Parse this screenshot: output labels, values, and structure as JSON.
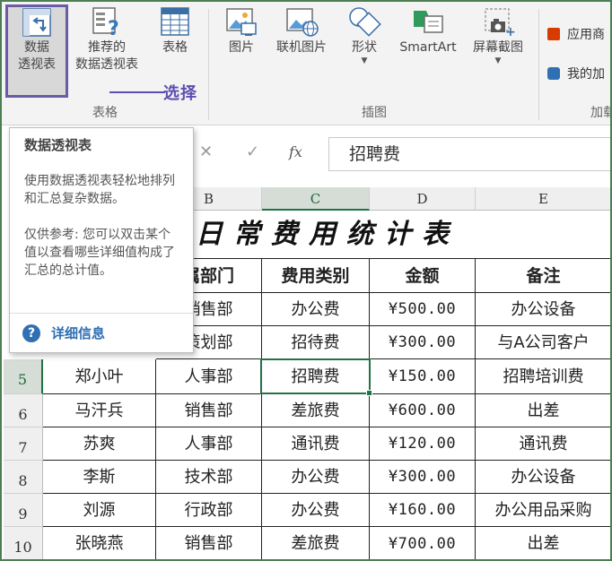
{
  "ribbon": {
    "buttons": {
      "pivot_table": {
        "label1": "数据",
        "label2": "透视表"
      },
      "recommended_pivot": {
        "label1": "推荐的",
        "label2": "数据透视表"
      },
      "table": {
        "label1": "表格"
      },
      "picture": {
        "label1": "图片"
      },
      "online_picture": {
        "label1": "联机图片"
      },
      "shapes": {
        "label1": "形状"
      },
      "smartart": {
        "label1": "SmartArt"
      },
      "screenshot": {
        "label1": "屏幕截图"
      }
    },
    "side": {
      "app_item": "应用商",
      "my_addins": "我的加"
    },
    "groups": {
      "tables": "表格",
      "illustrations": "插图",
      "addins": "加载"
    },
    "annotation": "选择"
  },
  "formula_bar": {
    "fx": "fx",
    "value": "招聘费"
  },
  "columns": [
    "B",
    "C",
    "D",
    "E"
  ],
  "selected_column": "C",
  "rows": [
    "5",
    "6",
    "7",
    "8",
    "9",
    "10"
  ],
  "selected_row": "5",
  "sheet": {
    "title": "日常费用统计表",
    "headers": [
      "属部门",
      "费用类别",
      "金额",
      "备注"
    ],
    "data": [
      {
        "name": "",
        "dept": "销售部",
        "type": "办公费",
        "amount": "¥500.00",
        "note": "办公设备"
      },
      {
        "name": "",
        "dept": "策划部",
        "type": "招待费",
        "amount": "¥300.00",
        "note": "与A公司客户"
      },
      {
        "name": "郑小叶",
        "dept": "人事部",
        "type": "招聘费",
        "amount": "¥150.00",
        "note": "招聘培训费"
      },
      {
        "name": "马汗兵",
        "dept": "销售部",
        "type": "差旅费",
        "amount": "¥600.00",
        "note": "出差"
      },
      {
        "name": "苏爽",
        "dept": "人事部",
        "type": "通讯费",
        "amount": "¥120.00",
        "note": "通讯费"
      },
      {
        "name": "李斯",
        "dept": "技术部",
        "type": "办公费",
        "amount": "¥300.00",
        "note": "办公设备"
      },
      {
        "name": "刘源",
        "dept": "行政部",
        "type": "办公费",
        "amount": "¥160.00",
        "note": "办公用品采购"
      },
      {
        "name": "张晓燕",
        "dept": "销售部",
        "type": "差旅费",
        "amount": "¥700.00",
        "note": "出差"
      }
    ]
  },
  "tooltip": {
    "title": "数据透视表",
    "desc": "使用数据透视表轻松地排列和汇总复杂数据。",
    "tip": "仅供参考: 您可以双击某个值以查看哪些详细值构成了汇总的总计值。",
    "more": "详细信息"
  },
  "colors": {
    "accent": "#217346",
    "annotation": "#5a4fb0",
    "help": "#2f6fb3"
  }
}
